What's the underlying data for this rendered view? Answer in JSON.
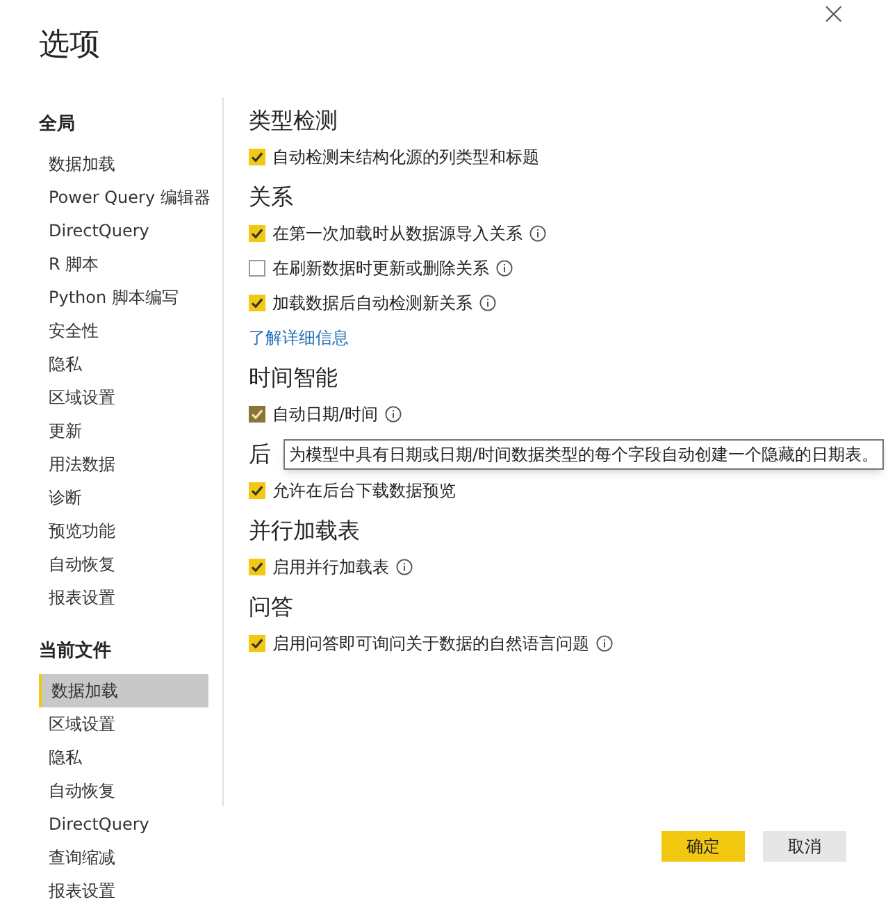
{
  "window": {
    "title": "选项",
    "close": "×"
  },
  "sidebar": {
    "groups": [
      {
        "title": "全局",
        "items": [
          {
            "label": "数据加载",
            "selected": false
          },
          {
            "label": "Power Query 编辑器",
            "selected": false
          },
          {
            "label": "DirectQuery",
            "selected": false
          },
          {
            "label": "R 脚本",
            "selected": false
          },
          {
            "label": "Python 脚本编写",
            "selected": false
          },
          {
            "label": "安全性",
            "selected": false
          },
          {
            "label": "隐私",
            "selected": false
          },
          {
            "label": "区域设置",
            "selected": false
          },
          {
            "label": "更新",
            "selected": false
          },
          {
            "label": "用法数据",
            "selected": false
          },
          {
            "label": "诊断",
            "selected": false
          },
          {
            "label": "预览功能",
            "selected": false
          },
          {
            "label": "自动恢复",
            "selected": false
          },
          {
            "label": "报表设置",
            "selected": false
          }
        ]
      },
      {
        "title": "当前文件",
        "items": [
          {
            "label": "数据加载",
            "selected": true
          },
          {
            "label": "区域设置",
            "selected": false
          },
          {
            "label": "隐私",
            "selected": false
          },
          {
            "label": "自动恢复",
            "selected": false
          },
          {
            "label": "DirectQuery",
            "selected": false
          },
          {
            "label": "查询缩减",
            "selected": false
          },
          {
            "label": "报表设置",
            "selected": false
          }
        ]
      }
    ]
  },
  "sections": [
    {
      "title": "类型检测",
      "items": [
        {
          "kind": "checkbox",
          "label": "自动检测未结构化源的列类型和标题",
          "checked": true,
          "info": false
        }
      ]
    },
    {
      "title": "关系",
      "items": [
        {
          "kind": "checkbox",
          "label": "在第一次加载时从数据源导入关系",
          "checked": true,
          "info": true
        },
        {
          "kind": "checkbox",
          "label": "在刷新数据时更新或删除关系",
          "checked": false,
          "info": true
        },
        {
          "kind": "checkbox",
          "label": "加载数据后自动检测新关系",
          "checked": true,
          "info": true
        },
        {
          "kind": "link",
          "label": "了解详细信息"
        }
      ]
    },
    {
      "title": "时间智能",
      "items": [
        {
          "kind": "checkbox",
          "label": "自动日期/时间",
          "checked": true,
          "hovered": true,
          "info": true
        }
      ]
    },
    {
      "title": "后",
      "tooltip": "为模型中具有日期或日期/时间数据类型的每个字段自动创建一个隐藏的日期表。",
      "items": [
        {
          "kind": "checkbox",
          "label": "允许在后台下载数据预览",
          "checked": true,
          "info": false
        }
      ]
    },
    {
      "title": "并行加载表",
      "items": [
        {
          "kind": "checkbox",
          "label": "启用并行加载表",
          "checked": true,
          "info": true
        }
      ]
    },
    {
      "title": "问答",
      "items": [
        {
          "kind": "checkbox",
          "label": "启用问答即可询问关于数据的自然语言问题",
          "checked": true,
          "info": true
        }
      ]
    }
  ],
  "buttons": [
    {
      "label": "确定",
      "kind": "primary"
    },
    {
      "label": "取消",
      "kind": "secondary"
    }
  ]
}
